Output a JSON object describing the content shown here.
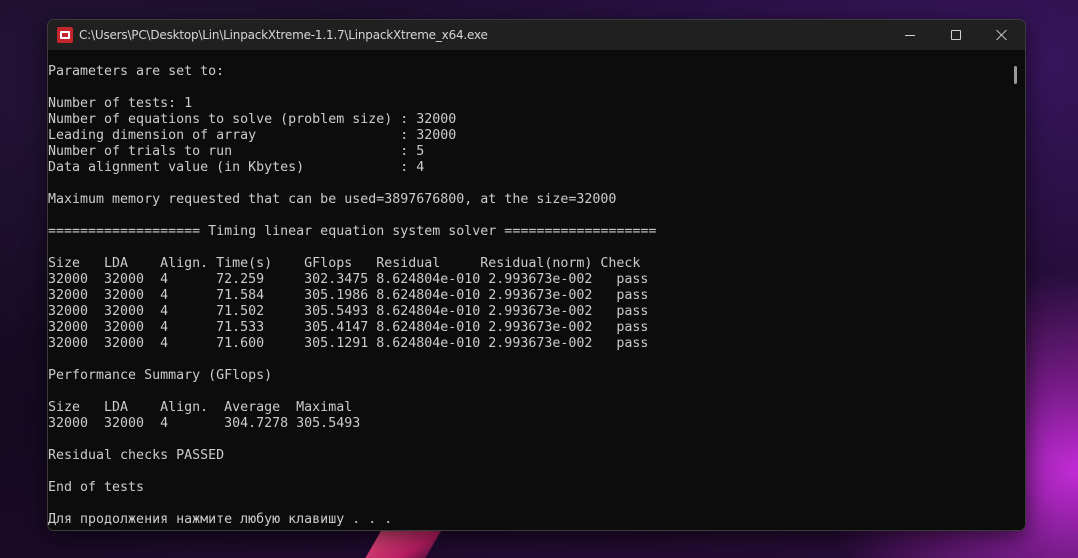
{
  "window": {
    "title": "C:\\Users\\PC\\Desktop\\Lin\\LinpackXtreme-1.1.7\\LinpackXtreme_x64.exe",
    "icon": "app-icon"
  },
  "caption_buttons": {
    "minimize": "minimize-icon",
    "maximize": "maximize-icon",
    "close": "close-icon"
  },
  "console": {
    "lines": [
      "Parameters are set to:",
      "",
      "Number of tests: 1",
      "Number of equations to solve (problem size) : 32000",
      "Leading dimension of array                  : 32000",
      "Number of trials to run                     : 5",
      "Data alignment value (in Kbytes)            : 4",
      "",
      "Maximum memory requested that can be used=3897676800, at the size=32000",
      "",
      "=================== Timing linear equation system solver ===================",
      "",
      "Size   LDA    Align. Time(s)    GFlops   Residual     Residual(norm) Check",
      "32000  32000  4      72.259     302.3475 8.624804e-010 2.993673e-002   pass",
      "32000  32000  4      71.584     305.1986 8.624804e-010 2.993673e-002   pass",
      "32000  32000  4      71.502     305.5493 8.624804e-010 2.993673e-002   pass",
      "32000  32000  4      71.533     305.4147 8.624804e-010 2.993673e-002   pass",
      "32000  32000  4      71.600     305.1291 8.624804e-010 2.993673e-002   pass",
      "",
      "Performance Summary (GFlops)",
      "",
      "Size   LDA    Align.  Average  Maximal",
      "32000  32000  4       304.7278 305.5493",
      "",
      "Residual checks PASSED",
      "",
      "End of tests",
      "",
      "Для продолжения нажмите любую клавишу . . ."
    ]
  }
}
